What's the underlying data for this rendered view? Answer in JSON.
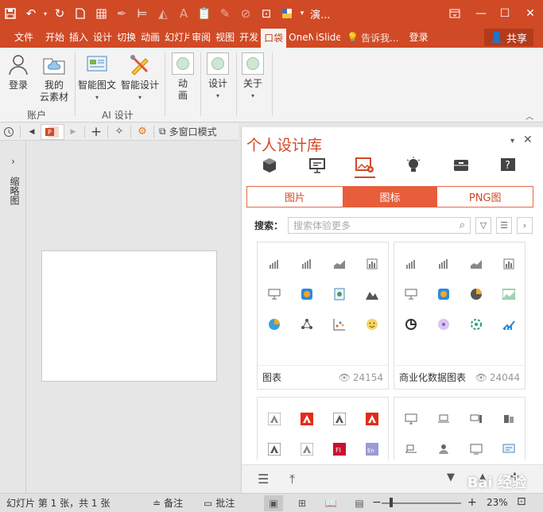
{
  "titlebar": {
    "title": "演...",
    "quick_access": [
      "save-icon",
      "undo-icon",
      "redo-icon",
      "new-file-icon",
      "grid-icon",
      "eyedropper-icon",
      "align-icon",
      "fill-icon",
      "text-color-icon",
      "paste-icon",
      "brush-icon",
      "shape-icon",
      "crop-icon",
      "color-icon"
    ],
    "window_controls": [
      "ribbon-display-icon",
      "minimize-icon",
      "maximize-icon",
      "close-icon"
    ]
  },
  "tabs": {
    "items": [
      "文件",
      "开始",
      "插入",
      "设计",
      "切换",
      "动画",
      "幻灯片",
      "审阅",
      "视图",
      "开发",
      "口袋",
      "OneNote",
      "iSlide"
    ],
    "tellme": "告诉我...",
    "login": "登录",
    "share": "共享"
  },
  "ribbon": {
    "login": "登录",
    "cloud_line1": "我的",
    "cloud_line2": "云素材",
    "group_account": "账户",
    "smart_graphic": "智能图文",
    "smart_design": "智能设计",
    "group_ai": "AI 设计",
    "anim_line1": "动",
    "anim_line2": "画",
    "design": "设计",
    "about": "关于"
  },
  "toolrow": {
    "multiwindow": "多窗口模式"
  },
  "leftstrip": {
    "label": "缩略图"
  },
  "panel": {
    "title": "个人设计库",
    "segments": [
      "图片",
      "图标",
      "PNG图"
    ],
    "active_segment": 1,
    "search_label": "搜索：",
    "search_placeholder": "搜索体验更多",
    "cards": [
      {
        "name": "图表",
        "views": "24154"
      },
      {
        "name": "商业化数据图表",
        "views": "24044"
      },
      {
        "name": "",
        "views": ""
      },
      {
        "name": "",
        "views": ""
      }
    ],
    "watermark": "Bai 经验"
  },
  "status": {
    "slide_info": "幻灯片 第 1 张，共 1 张",
    "notes": "备注",
    "comments": "批注",
    "zoom": "23%"
  },
  "colors": {
    "accent": "#d04a26",
    "segment_active": "#e85d3a"
  }
}
